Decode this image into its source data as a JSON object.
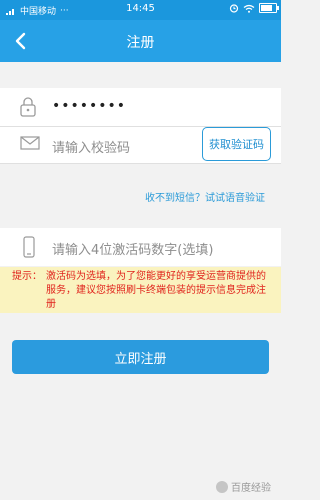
{
  "status_bar": {
    "carrier": "中国移动",
    "time": "14:45",
    "battery_level": 0.8,
    "signal_icon": "signal-icon",
    "wifi_icon": "wifi-icon",
    "alarm_icon": "alarm-icon"
  },
  "header": {
    "title": "注册",
    "back_icon": "chevron-left-icon"
  },
  "password_field": {
    "value": "••••••••",
    "icon": "lock-icon"
  },
  "verification_field": {
    "placeholder": "请输入校验码",
    "icon": "mail-icon",
    "button_label": "获取验证码"
  },
  "voice_link": {
    "text": "收不到短信？试试语音验证"
  },
  "activation_field": {
    "placeholder": "请输入4位激活码数字(选填)",
    "icon": "phone-icon"
  },
  "notice": {
    "label": "提示：",
    "text": "激活码为选填，为了您能更好的享受运营商提供的服务，建议您按照刷卡终端包装的提示信息完成注册"
  },
  "submit": {
    "label": "立即注册"
  },
  "watermark": {
    "text": "百度经验"
  },
  "colors": {
    "accent": "#27a1e6",
    "warning": "#e0231c",
    "notice_bg": "#faf3bf"
  }
}
